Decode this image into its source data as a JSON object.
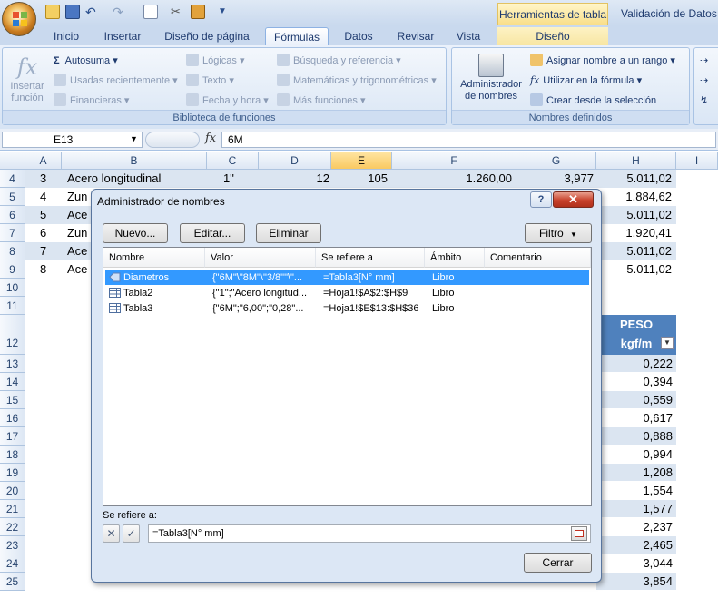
{
  "titlebar": {
    "contextual_tab_group": "Herramientas de tabla",
    "window_title": "Validación de Datos"
  },
  "ribbon_tabs": [
    "Inicio",
    "Insertar",
    "Diseño de página",
    "Fórmulas",
    "Datos",
    "Revisar",
    "Vista",
    "Diseño"
  ],
  "ribbon": {
    "insert_function": [
      "Insertar",
      "función"
    ],
    "autosum": "Autosuma",
    "recent": "Usadas recientemente",
    "financial": "Financieras",
    "logical": "Lógicas",
    "text": "Texto",
    "datetime": "Fecha y hora",
    "lookup": "Búsqueda y referencia",
    "math": "Matemáticas y trigonométricas",
    "more": "Más funciones",
    "library_label": "Biblioteca de funciones",
    "name_manager": [
      "Administrador",
      "de nombres"
    ],
    "define_name": "Asignar nombre a un rango",
    "use_in_formula": "Utilizar en la fórmula",
    "create_from_selection": "Crear desde la selección",
    "defined_names_label": "Nombres definidos"
  },
  "formula_bar": {
    "name_box": "E13",
    "fx": "fx",
    "value": "6M"
  },
  "sheet": {
    "columns": [
      "A",
      "B",
      "C",
      "D",
      "E",
      "F",
      "G",
      "H",
      "I"
    ],
    "rows": [
      {
        "num": "4",
        "a": "3",
        "b": "Acero longitudinal",
        "c": "1\"",
        "d": "12",
        "e": "105",
        "f": "1.260,00",
        "g": "3,977",
        "h": "5.011,02"
      },
      {
        "num": "5",
        "a": "4",
        "b": "Zun",
        "h": "1.884,62"
      },
      {
        "num": "6",
        "a": "5",
        "b": "Ace",
        "h": "5.011,02"
      },
      {
        "num": "7",
        "a": "6",
        "b": "Zun",
        "h": "1.920,41"
      },
      {
        "num": "8",
        "a": "7",
        "b": "Ace",
        "h": "5.011,02"
      },
      {
        "num": "9",
        "a": "8",
        "b": "Ace",
        "h": "5.011,02"
      }
    ],
    "rows_10_11": [
      "10",
      "11"
    ],
    "row12": "12",
    "peso_header": [
      "PESO",
      "kgf/m"
    ],
    "lower_rows": [
      {
        "num": "13",
        "h": "0,222"
      },
      {
        "num": "14",
        "h": "0,394"
      },
      {
        "num": "15",
        "h": "0,559"
      },
      {
        "num": "16",
        "h": "0,617"
      },
      {
        "num": "17",
        "h": "0,888"
      },
      {
        "num": "18",
        "h": "0,994"
      },
      {
        "num": "19",
        "h": "1,208"
      },
      {
        "num": "20",
        "h": "1,554"
      },
      {
        "num": "21",
        "h": "1,577"
      },
      {
        "num": "22",
        "h": "2,237"
      },
      {
        "num": "23",
        "h": "2,465"
      },
      {
        "num": "24",
        "h": "3,044"
      },
      {
        "num": "25",
        "h": "3,854"
      }
    ]
  },
  "dialog": {
    "title": "Administrador de nombres",
    "help": "?",
    "close": "✕",
    "btn_new": "Nuevo...",
    "btn_edit": "Editar...",
    "btn_delete": "Eliminar",
    "btn_filter": "Filtro",
    "headers": [
      "Nombre",
      "Valor",
      "Se refiere a",
      "Ámbito",
      "Comentario"
    ],
    "rows": [
      {
        "name": "Diametros",
        "value": "{\"6M\"\\\"8M\"\\\"3/8\"\"\\\"...",
        "ref": "=Tabla3[N°         mm]",
        "scope": "Libro"
      },
      {
        "name": "Tabla2",
        "value": "{\"1\";\"Acero longitud...",
        "ref": "=Hoja1!$A$2:$H$9",
        "scope": "Libro"
      },
      {
        "name": "Tabla3",
        "value": "{\"6M\";\"6,00\";\"0,28\"...",
        "ref": "=Hoja1!$E$13:$H$36",
        "scope": "Libro"
      }
    ],
    "refers_label": "Se refiere a:",
    "refers_value": "=Tabla3[N°         mm]",
    "btn_close": "Cerrar"
  }
}
